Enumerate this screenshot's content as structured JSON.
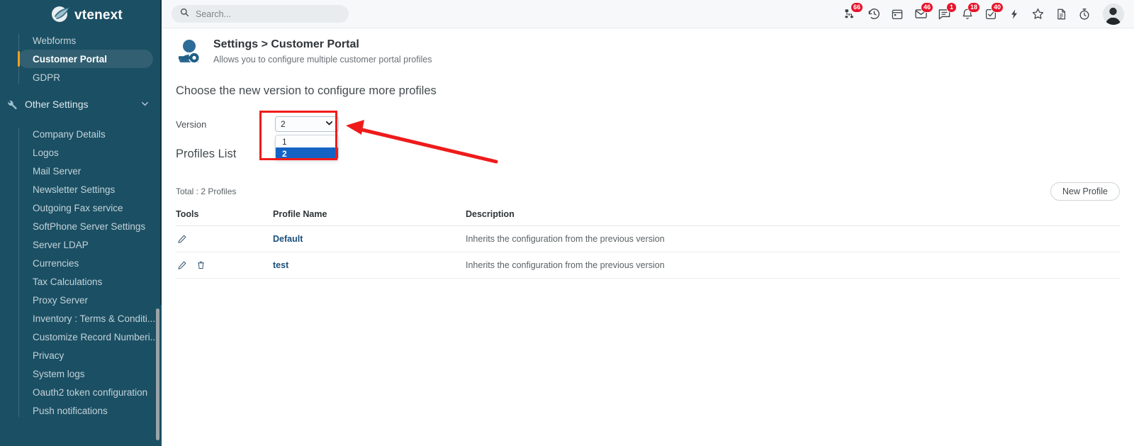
{
  "brand": {
    "name": "vtenext",
    "logo_icon": "vtenext-logo-icon"
  },
  "sidebar": {
    "primary_items": [
      {
        "label": "Webforms",
        "active": false
      },
      {
        "label": "Customer Portal",
        "active": true
      },
      {
        "label": "GDPR",
        "active": false
      }
    ],
    "group_header": {
      "label": "Other Settings",
      "icon": "wrench-icon",
      "chevron": "chevron-down-icon"
    },
    "other_items": [
      {
        "label": "Company Details"
      },
      {
        "label": "Logos"
      },
      {
        "label": "Mail Server"
      },
      {
        "label": "Newsletter Settings"
      },
      {
        "label": "Outgoing Fax service"
      },
      {
        "label": "SoftPhone Server Settings"
      },
      {
        "label": "Server LDAP"
      },
      {
        "label": "Currencies"
      },
      {
        "label": "Tax Calculations"
      },
      {
        "label": "Proxy Server"
      },
      {
        "label": "Inventory : Terms & Conditi..."
      },
      {
        "label": "Customize Record Numberi..."
      },
      {
        "label": "Privacy"
      },
      {
        "label": "System logs"
      },
      {
        "label": "Oauth2 token configuration"
      },
      {
        "label": "Push notifications"
      }
    ]
  },
  "topbar": {
    "search": {
      "placeholder": "Search...",
      "value": "",
      "icon": "search-icon"
    },
    "icons": [
      {
        "name": "org-chart-icon",
        "badge": "66"
      },
      {
        "name": "history-clock-icon",
        "badge": ""
      },
      {
        "name": "calendar-icon",
        "badge": ""
      },
      {
        "name": "mail-icon",
        "badge": "46"
      },
      {
        "name": "chat-icon",
        "badge": "1"
      },
      {
        "name": "bell-icon",
        "badge": "18"
      },
      {
        "name": "task-check-icon",
        "badge": "40"
      },
      {
        "name": "lightning-icon",
        "badge": ""
      },
      {
        "name": "star-icon",
        "badge": ""
      },
      {
        "name": "document-icon",
        "badge": ""
      },
      {
        "name": "timer-icon",
        "badge": ""
      }
    ],
    "avatar": "user-avatar"
  },
  "page": {
    "icon": "user-key-icon",
    "title": "Settings > Customer Portal",
    "subtitle": "Allows you to configure multiple customer portal profiles",
    "section_heading": "Choose the new version to configure more profiles",
    "profiles_heading": "Profiles List"
  },
  "version_field": {
    "label": "Version",
    "selected": "2",
    "options": [
      "1",
      "2"
    ],
    "chevron_icon": "chevron-down-icon",
    "highlight_color": "#ef1b1b",
    "selected_option_color": "#1463c4"
  },
  "annotation": {
    "arrow_color": "#ef1b1b",
    "name": "red-pointer-arrow"
  },
  "profiles": {
    "total_text": "Total : 2 Profiles",
    "new_profile_label": "New Profile",
    "columns": [
      "Tools",
      "Profile Name",
      "Description"
    ],
    "rows": [
      {
        "tools": [
          "edit-pencil-icon"
        ],
        "name": "Default",
        "description": "Inherits the configuration from the previous version"
      },
      {
        "tools": [
          "edit-pencil-icon",
          "delete-trash-icon"
        ],
        "name": "test",
        "description": "Inherits the configuration from the previous version"
      }
    ]
  }
}
